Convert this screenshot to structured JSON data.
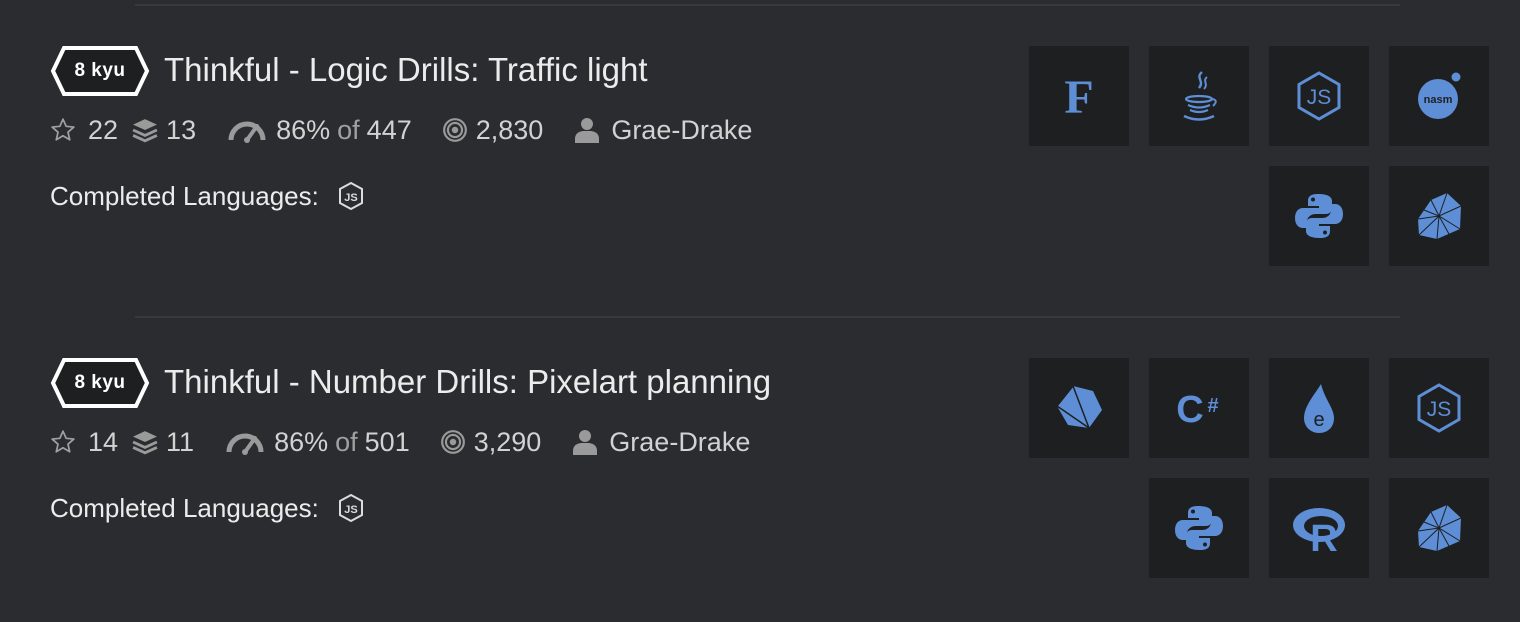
{
  "colors": {
    "background": "#2b2c2f",
    "tile": "#1e1f21",
    "accent": "#5d8ed6",
    "rank_white": "#ffffff"
  },
  "katas": [
    {
      "rank": "8 kyu",
      "title": "Thinkful - Logic Drills: Traffic light",
      "stars": "22",
      "collections": "13",
      "satisfaction_percent": "86%",
      "of_label": "of",
      "votes": "447",
      "completions": "2,830",
      "author": "Grae-Drake",
      "completed_label": "Completed Languages:",
      "completed_languages": [
        "javascript-icon"
      ],
      "languages": [
        "fsharp-icon",
        "java-icon",
        "javascript-icon",
        "nasm-icon",
        "python-icon",
        "ruby-icon"
      ]
    },
    {
      "rank": "8 kyu",
      "title": "Thinkful - Number Drills: Pixelart planning",
      "stars": "14",
      "collections": "11",
      "satisfaction_percent": "86%",
      "of_label": "of",
      "votes": "501",
      "completions": "3,290",
      "author": "Grae-Drake",
      "completed_label": "Completed Languages:",
      "completed_languages": [
        "javascript-icon"
      ],
      "languages": [
        "crystal-icon",
        "csharp-icon",
        "elixir-icon",
        "javascript-icon",
        "python-icon",
        "r-icon",
        "ruby-icon"
      ]
    }
  ]
}
